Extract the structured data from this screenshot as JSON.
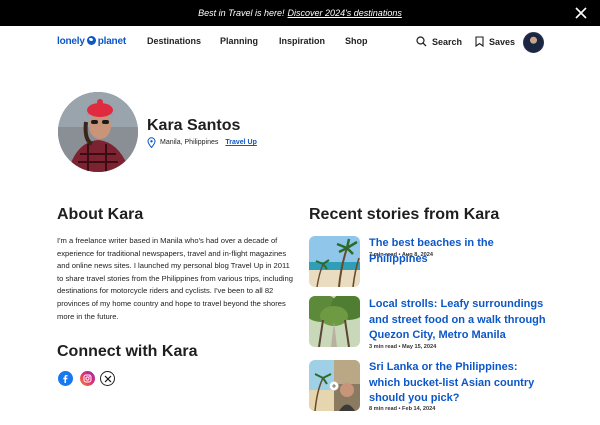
{
  "banner": {
    "text": "Best in Travel is here!",
    "link": "Discover 2024's destinations"
  },
  "header": {
    "logo": {
      "left": "lonely",
      "right": "planet"
    },
    "nav": [
      "Destinations",
      "Planning",
      "Inspiration",
      "Shop"
    ],
    "search_label": "Search",
    "saves_label": "Saves"
  },
  "profile": {
    "name": "Kara Santos",
    "location": "Manila, Philippines",
    "blog_link": "Travel Up"
  },
  "about": {
    "heading": "About Kara",
    "bio": "I'm a freelance writer based in Manila who's had over a decade of experience for traditional newspapers, travel and in-flight magazines and online news sites. I launched my personal blog Travel Up in 2011 to share travel stories from the Philippines from various trips, including destinations for motorcycle riders and cyclists. I've been to all 82 provinces of my home country and hope to travel beyond the shores more in the future."
  },
  "connect": {
    "heading": "Connect with Kara",
    "networks": [
      "facebook-icon",
      "instagram-icon",
      "x-icon"
    ]
  },
  "recent": {
    "heading": "Recent stories from Kara",
    "stories": [
      {
        "title": "The best beaches in the Philippines",
        "meta": "7 min read • Aug 8, 2024"
      },
      {
        "title": "Local strolls: Leafy surroundings and street food on a walk through Quezon City, Metro Manila",
        "meta": "3 min read • May 15, 2024"
      },
      {
        "title": "Sri Lanka or the Philippines: which bucket-list Asian country should you pick?",
        "meta": "8 min read • Feb 14, 2024"
      }
    ]
  },
  "colors": {
    "brand": "#0d57c6",
    "banner_bg": "#000000",
    "text": "#1f1f1f"
  }
}
